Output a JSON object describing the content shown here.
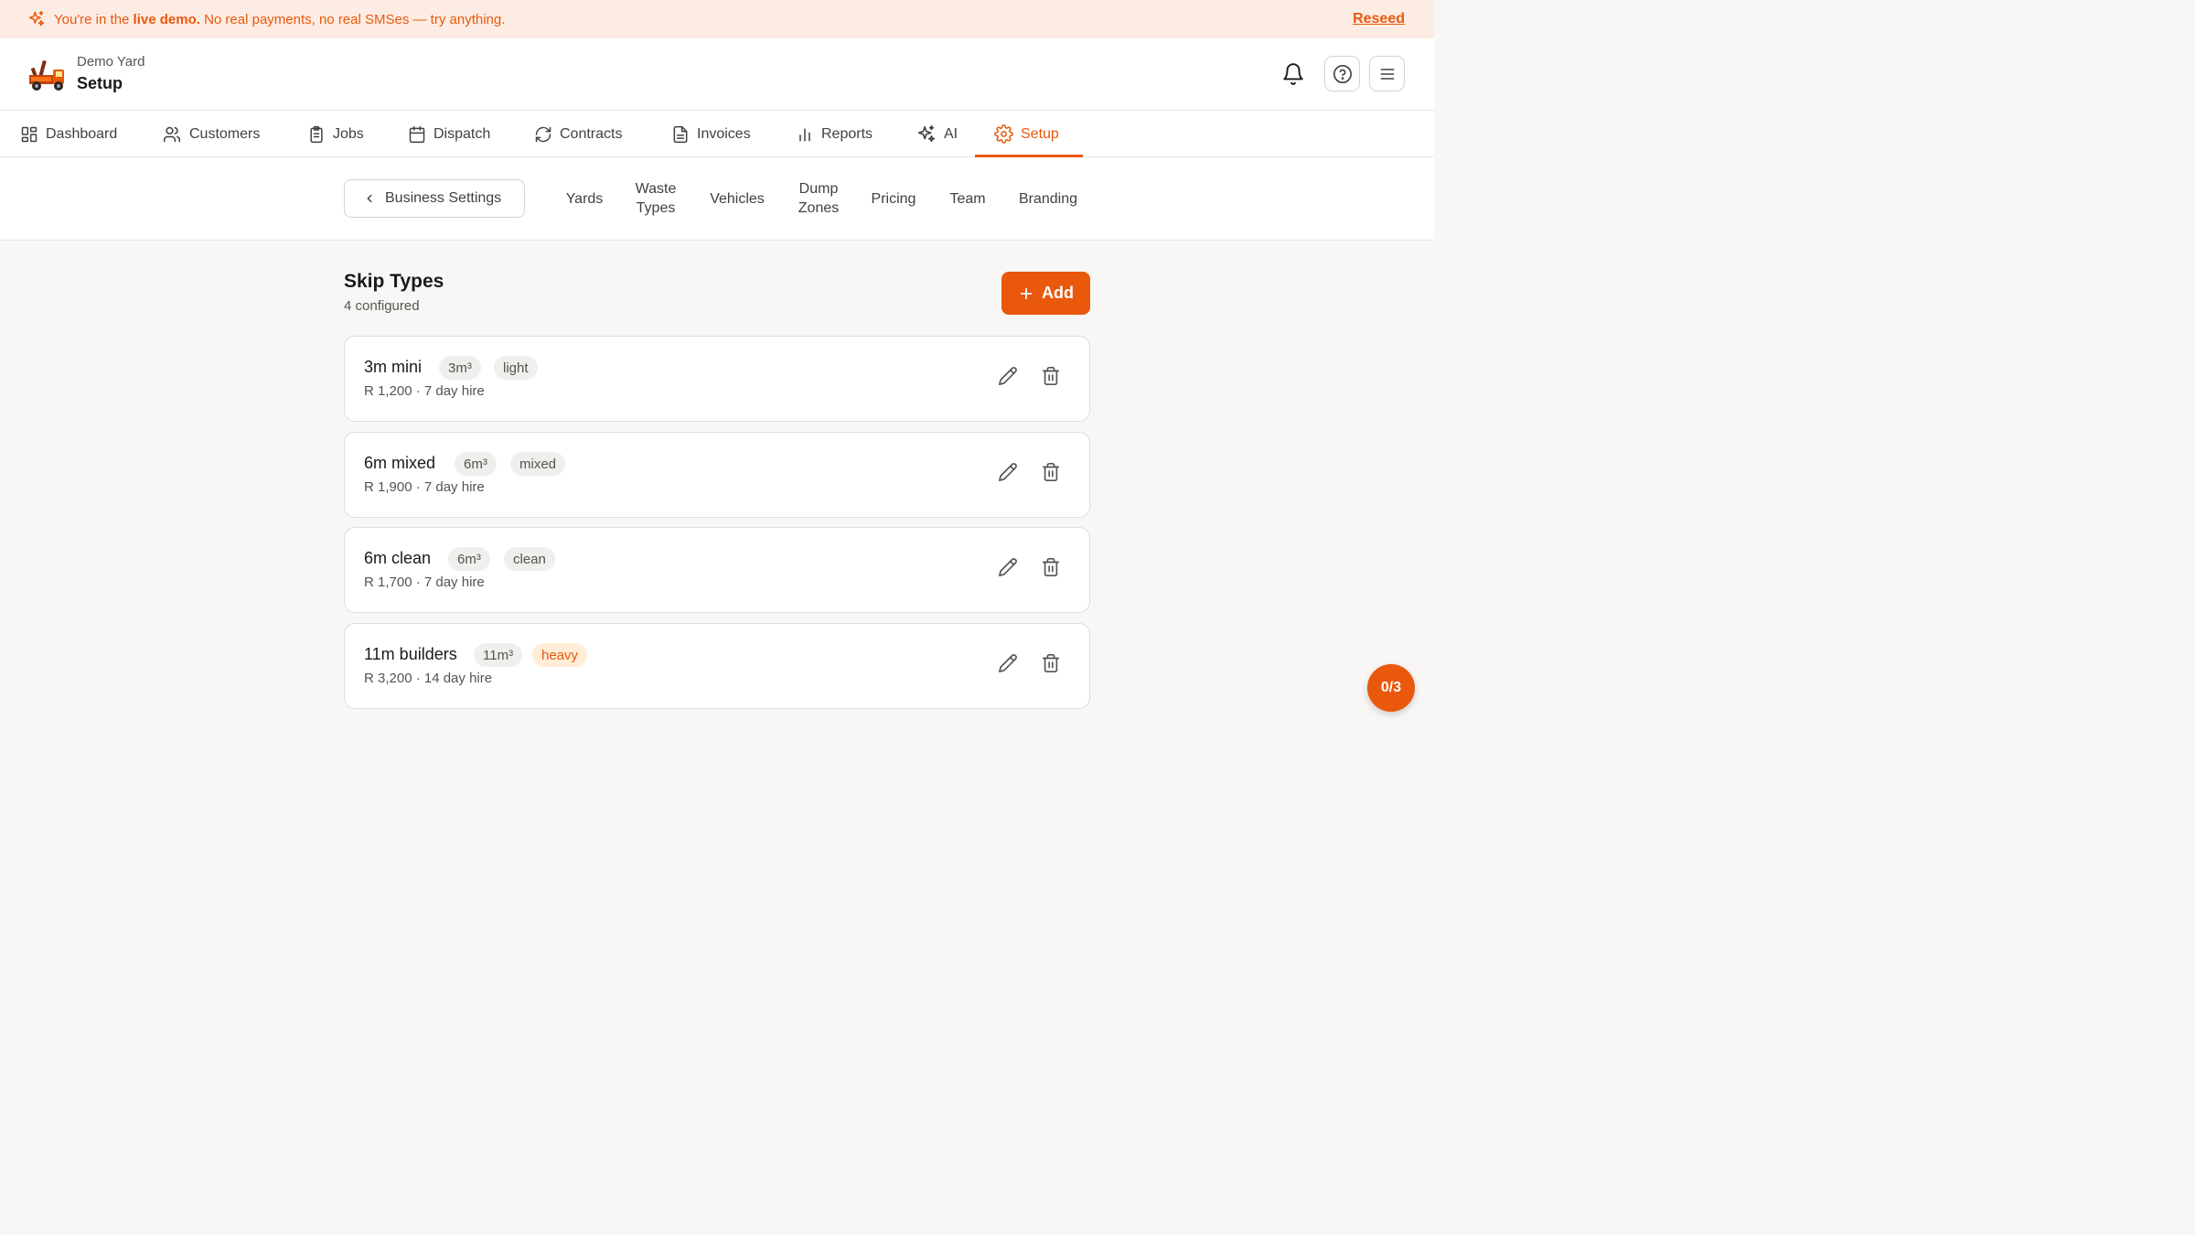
{
  "banner": {
    "prefix": "You're in the ",
    "highlight": "live demo.",
    "suffix": " No real payments, no real SMSes — try anything.",
    "reseed": "Reseed",
    "icon": "sparkles-icon"
  },
  "header": {
    "yard_name": "Demo Yard",
    "page_title": "Setup",
    "icons": [
      "bell-icon",
      "help-icon",
      "menu-icon"
    ]
  },
  "nav": {
    "items": [
      {
        "label": "Dashboard",
        "icon": "dashboard-icon"
      },
      {
        "label": "Customers",
        "icon": "users-icon"
      },
      {
        "label": "Jobs",
        "icon": "clipboard-icon"
      },
      {
        "label": "Dispatch",
        "icon": "calendar-icon"
      },
      {
        "label": "Contracts",
        "icon": "refresh-icon"
      },
      {
        "label": "Invoices",
        "icon": "document-icon"
      },
      {
        "label": "Reports",
        "icon": "bar-chart-icon"
      },
      {
        "label": "AI",
        "icon": "sparkles-icon"
      },
      {
        "label": "Setup",
        "icon": "gear-icon"
      }
    ],
    "active": "Setup"
  },
  "subnav": {
    "back_label": "Business Settings",
    "items": [
      {
        "line1": "Yards",
        "line2": ""
      },
      {
        "line1": "Waste",
        "line2": "Types"
      },
      {
        "line1": "Vehicles",
        "line2": ""
      },
      {
        "line1": "Dump",
        "line2": "Zones"
      },
      {
        "line1": "Pricing",
        "line2": ""
      },
      {
        "line1": "Team",
        "line2": ""
      },
      {
        "line1": "Branding",
        "line2": ""
      }
    ]
  },
  "section": {
    "title": "Skip Types",
    "subtitle": "4 configured",
    "add_label": "Add"
  },
  "skip_types": [
    {
      "name": "3m mini",
      "size": "3m³",
      "weight": "light",
      "desc": "R 1,200 · 7 day hire"
    },
    {
      "name": "6m mixed",
      "size": "6m³",
      "weight": "mixed",
      "desc": "R 1,900 · 7 day hire"
    },
    {
      "name": "6m clean",
      "size": "6m³",
      "weight": "clean",
      "desc": "R 1,700 · 7 day hire"
    },
    {
      "name": "11m builders",
      "size": "11m³",
      "weight": "heavy",
      "desc": "R 3,200 · 14 day hire"
    }
  ],
  "fab": {
    "label": "0/3"
  },
  "colors": {
    "accent": "#ea580c",
    "banner_bg": "#fdece3",
    "page_bg": "#f8f7f6",
    "heavy_bg": "#ffedd5"
  }
}
